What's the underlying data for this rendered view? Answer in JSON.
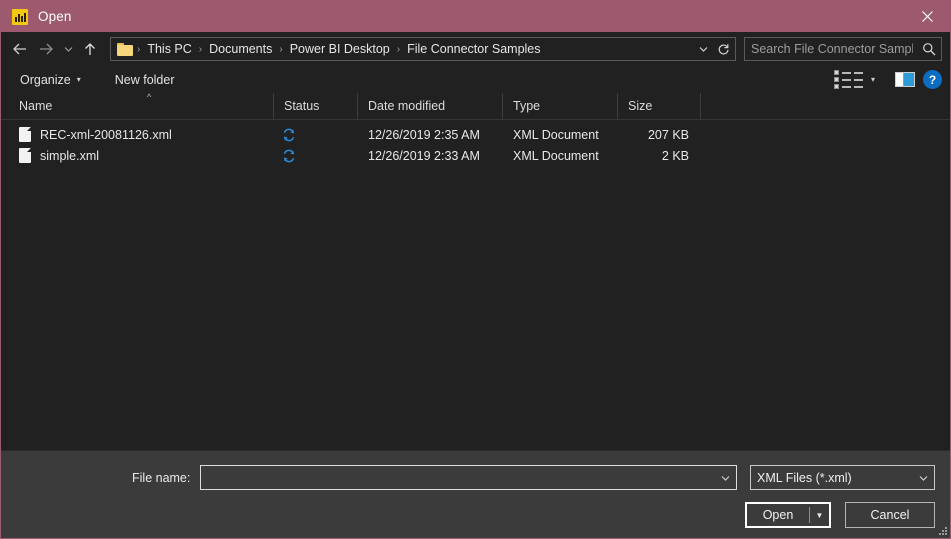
{
  "window": {
    "title": "Open",
    "app_icon": "powerbi-chart-icon",
    "close_label": "✕",
    "accent_color": "#9d5a6e",
    "background_color": "#212121",
    "footer_color": "#3b3b3b"
  },
  "nav": {
    "back": "←",
    "forward": "→",
    "recent": "˅",
    "up": "↑",
    "refresh": "⟳",
    "dropdown": "˅"
  },
  "breadcrumb": {
    "folder_icon": "folder-icon",
    "separator": "›",
    "items": [
      {
        "label": "This PC"
      },
      {
        "label": "Documents"
      },
      {
        "label": "Power BI Desktop"
      },
      {
        "label": "File Connector Samples"
      }
    ]
  },
  "search": {
    "placeholder": "Search File Connector Samples",
    "value": ""
  },
  "toolbar": {
    "organize_label": "Organize",
    "organize_caret": "▾",
    "new_folder_label": "New folder",
    "view_caret": "▾",
    "help_label": "?"
  },
  "columns": {
    "sort_indicator": "^",
    "headers": [
      {
        "label": "Name"
      },
      {
        "label": "Status"
      },
      {
        "label": "Date modified"
      },
      {
        "label": "Type"
      },
      {
        "label": "Size"
      }
    ]
  },
  "files": [
    {
      "name": "REC-xml-20081126.xml",
      "status": "sync-icon",
      "date_modified": "12/26/2019 2:35 AM",
      "type": "XML Document",
      "size": "207 KB"
    },
    {
      "name": "simple.xml",
      "status": "sync-icon",
      "date_modified": "12/26/2019 2:33 AM",
      "type": "XML Document",
      "size": "2 KB"
    }
  ],
  "footer": {
    "file_name_label": "File name:",
    "file_name_value": "",
    "file_name_placeholder": "",
    "filter_value": "XML Files (*.xml)",
    "filter_caret": "˅",
    "open_label": "Open",
    "open_caret": "▼",
    "cancel_label": "Cancel"
  }
}
